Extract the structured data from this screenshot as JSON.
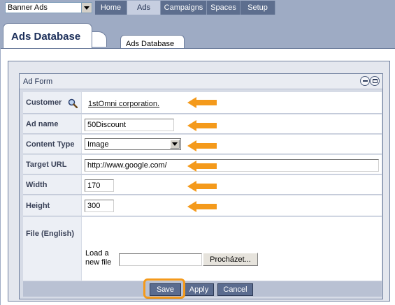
{
  "topnav": {
    "app_select": "Banner Ads",
    "tabs": [
      {
        "label": "Home",
        "active": false
      },
      {
        "label": "Ads",
        "active": true
      },
      {
        "label": "Campaigns",
        "active": false
      },
      {
        "label": "Spaces",
        "active": false
      },
      {
        "label": "Setup",
        "active": false
      }
    ]
  },
  "page": {
    "main_tab": "Ads Database",
    "sub_tab": "Ads Database"
  },
  "form": {
    "title": "Ad Form",
    "customer": {
      "label": "Customer",
      "value": "1stOmni corporation."
    },
    "ad_name": {
      "label": "Ad name",
      "value": "50Discount"
    },
    "content_type": {
      "label": "Content Type",
      "value": "Image"
    },
    "target_url": {
      "label": "Target URL",
      "value": "http://www.google.com/"
    },
    "width": {
      "label": "Width",
      "value": "170"
    },
    "height": {
      "label": "Height",
      "value": "300"
    },
    "file": {
      "label": "File (English)",
      "upload_label": "Load a new file",
      "file_value": "",
      "browse_label": "Procházet..."
    },
    "buttons": {
      "save": "Save",
      "apply": "Apply",
      "cancel": "Cancel"
    }
  },
  "colors": {
    "accent": "#f49a1c",
    "nav": "#5d6e8e",
    "workspace": "#9eabc4"
  }
}
